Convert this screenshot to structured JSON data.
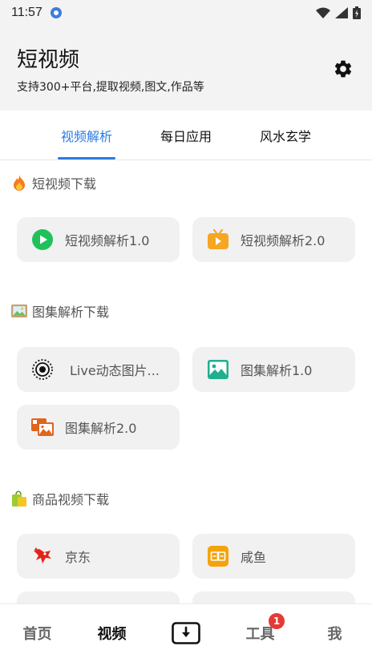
{
  "status_bar": {
    "time": "11:57"
  },
  "header": {
    "title": "短视频",
    "subtitle": "支持300+平台,提取视频,图文,作品等"
  },
  "tabs": [
    {
      "label": "视频解析",
      "active": true
    },
    {
      "label": "每日应用",
      "active": false
    },
    {
      "label": "风水玄学",
      "active": false
    }
  ],
  "sections": [
    {
      "title": "短视频下载",
      "icon": "fire-icon",
      "items": [
        {
          "label": "短视频解析1.0",
          "icon": "green-play-icon"
        },
        {
          "label": "短视频解析2.0",
          "icon": "orange-tv-icon"
        }
      ]
    },
    {
      "title": "图集解析下载",
      "icon": "picture-frame-icon",
      "items": [
        {
          "label": "Live动态图片...",
          "icon": "live-photo-icon"
        },
        {
          "label": "图集解析1.0",
          "icon": "teal-image-icon"
        },
        {
          "label": "图集解析2.0",
          "icon": "orange-gallery-icon"
        }
      ]
    },
    {
      "title": "商品视频下载",
      "icon": "shopping-bags-icon",
      "items": [
        {
          "label": "京东",
          "icon": "jd-dog-icon"
        },
        {
          "label": "咸鱼",
          "icon": "xianyu-icon"
        }
      ]
    }
  ],
  "bottom_nav": {
    "items": [
      {
        "label": "首页",
        "active": false
      },
      {
        "label": "视频",
        "active": true
      },
      {
        "label": "",
        "icon": "download-box-icon"
      },
      {
        "label": "工具",
        "active": false,
        "badge": "1"
      },
      {
        "label": "我",
        "active": false
      }
    ]
  },
  "colors": {
    "accent": "#2a7be4",
    "header_bg": "#f3f3f3",
    "card_bg": "#f1f1f1",
    "badge": "#e53935"
  }
}
